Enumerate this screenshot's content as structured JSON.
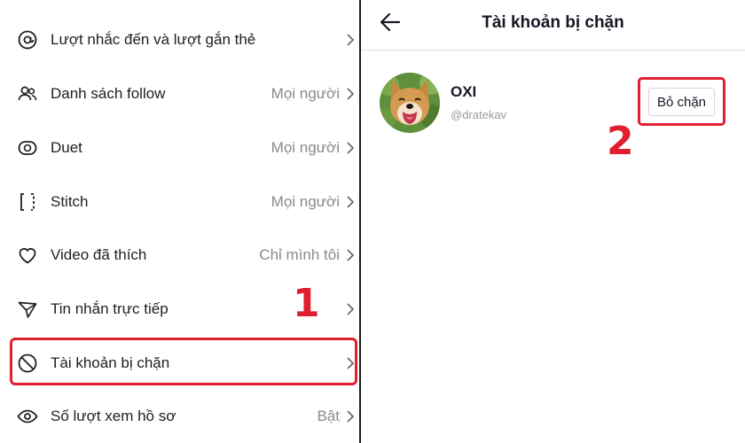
{
  "settings": {
    "items": [
      {
        "label": "Lượt nhắc đến và lượt gắn thẻ",
        "value": "",
        "icon": "at-icon"
      },
      {
        "label": "Danh sách follow",
        "value": "Mọi người",
        "icon": "people-icon"
      },
      {
        "label": "Duet",
        "value": "Mọi người",
        "icon": "duet-icon"
      },
      {
        "label": "Stitch",
        "value": "Mọi người",
        "icon": "stitch-icon"
      },
      {
        "label": "Video đã thích",
        "value": "Chỉ mình tôi",
        "icon": "heart-icon"
      },
      {
        "label": "Tin nhắn trực tiếp",
        "value": "",
        "icon": "send-icon"
      },
      {
        "label": "Tài khoản bị chặn",
        "value": "",
        "icon": "block-icon"
      },
      {
        "label": "Số lượt xem hồ sơ",
        "value": "Bật",
        "icon": "eye-icon"
      }
    ]
  },
  "annotations": {
    "step1": "1",
    "step2": "2",
    "color": "#e0202e"
  },
  "blocked_page": {
    "title": "Tài khoản bị chặn",
    "account": {
      "name": "OXI",
      "handle": "@dratekav"
    },
    "unblock_label": "Bỏ chặn"
  }
}
